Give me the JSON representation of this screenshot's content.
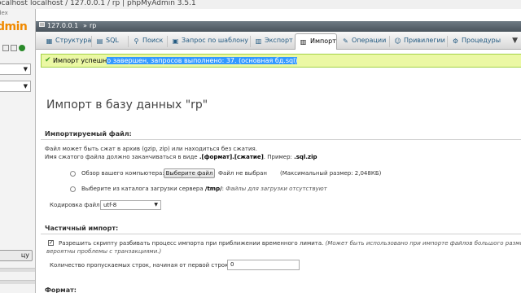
{
  "window": {
    "url_fragment": "ocalhost",
    "title": "localhost / 127.0.0.1 / rp | phpMyAdmin 3.5.1"
  },
  "left": {
    "tab_fragment": "dex",
    "logo_fragment": "dmin",
    "select1_value": "",
    "select2_value": "",
    "button_fragment": "цу"
  },
  "serverbar": {
    "server": "127.0.0.1",
    "separator": "»",
    "db": "rp"
  },
  "tabs": [
    {
      "label": "Структура",
      "icon": "structure-icon"
    },
    {
      "label": "SQL",
      "icon": "sql-icon"
    },
    {
      "label": "Поиск",
      "icon": "search-icon"
    },
    {
      "label": "Запрос по шаблону",
      "icon": "query-icon"
    },
    {
      "label": "Экспорт",
      "icon": "export-icon"
    },
    {
      "label": "Импорт",
      "icon": "import-icon"
    },
    {
      "label": "Операции",
      "icon": "operations-icon"
    },
    {
      "label": "Привилегии",
      "icon": "privileges-icon"
    },
    {
      "label": "Процедуры",
      "icon": "procedures-icon"
    }
  ],
  "message": {
    "prefix": "Импорт успешн",
    "selected": "о завершен, запросов выполнено: 37. (основная бд.sql)"
  },
  "page_title": "Импорт в базу данных \"rp\"",
  "file_section": {
    "legend": "Импортируемый файл:",
    "line1": "Файл может быть сжат в архив (gzip, zip) или находиться без сжатия.",
    "line2_prefix": "Имя сжатого файла должно заканчиваться в виде ",
    "line2_format": ".[формат].[сжатие]",
    "line2_mid": ". Пример: ",
    "line2_example": ".sql.zip",
    "option1_label": "Обзор вашего компьютера:",
    "choose_button": "Выберите файл",
    "no_file": "Файл не выбран",
    "max_size": "(Максимальный размер: 2,048КБ)",
    "option2_label": "Выберите из каталога загрузки сервера",
    "option2_path": "/tmp/",
    "option2_colon": ":",
    "option2_note": "Файлы для загрузки отсутствуют",
    "encoding_label": "Кодировка файла:",
    "encoding_value": "utf-8"
  },
  "partial_section": {
    "legend": "Частичный импорт:",
    "allow_text": "Разрешить скрипту разбивать процесс импорта при приближении временного лимита.",
    "allow_note_1": "(Может быть использовано при импорте файлов большого размера, оди",
    "allow_note_2": "вероятны проблемы с транзакциями.)",
    "skip_label": "Количество пропускаемых строк, начиная от первой строки:",
    "skip_value": "0"
  },
  "format_section": {
    "legend": "Формат:"
  }
}
